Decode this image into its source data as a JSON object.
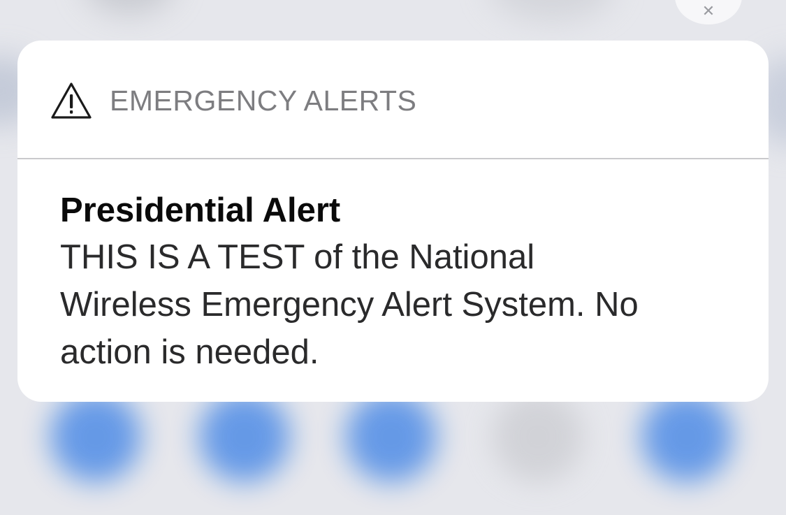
{
  "notification": {
    "app_name": "EMERGENCY ALERTS",
    "icon": "warning-triangle-icon",
    "title": "Presidential Alert",
    "message_lines": [
      "THIS IS A TEST of the National",
      "Wireless Emergency Alert System. No",
      "action is needed."
    ]
  },
  "colors": {
    "card_background": "#ffffff",
    "header_text": "#7d7d80",
    "app_icon_blue": "#4f8ce6"
  }
}
